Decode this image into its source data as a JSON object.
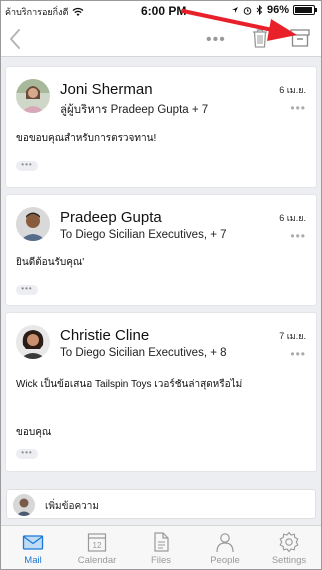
{
  "statusbar": {
    "carrier": "ค้าบริการอยกิ่งตี",
    "time": "6:00 PM",
    "battery": "96%",
    "battery_level": 0.96
  },
  "toolbar": {
    "more": "•••"
  },
  "messages": [
    {
      "sender": "Joni Sherman",
      "recipients": "ลู่ผู้บริหาร Pradeep Gupta + 7",
      "date": "6 เม.ย.",
      "body": [
        "ขอขอบคุณสำหรับการตรวจทาน!"
      ],
      "expand": "•••",
      "more": "•••"
    },
    {
      "sender": "Pradeep Gupta",
      "recipients": "To Diego Sicilian Executives, + 7",
      "date": "6 เม.ย.",
      "body": [
        "ยินดีต้อนรับคุณ'"
      ],
      "expand": "•••",
      "more": "•••"
    },
    {
      "sender": "Christie Cline",
      "recipients": "To Diego Sicilian Executives, + 8",
      "date": "7 เม.ย.",
      "body": [
        "Wick เป็นข้อเสนอ Tailspin Toys เวอร์ชันล่าสุดหรือไม่",
        "ขอบคุณ"
      ],
      "expand": "•••",
      "more": "•••"
    }
  ],
  "reply": {
    "placeholder": "เพิ่มข้อความ"
  },
  "tabs": [
    {
      "label": "Mail",
      "icon": "mail-icon",
      "active": true
    },
    {
      "label": "Calendar",
      "icon": "calendar-icon",
      "day": "12"
    },
    {
      "label": "Files",
      "icon": "files-icon"
    },
    {
      "label": "People",
      "icon": "people-icon"
    },
    {
      "label": "Settings",
      "icon": "settings-icon"
    }
  ],
  "colors": {
    "accent": "#1b78d6",
    "arrow": "#e8202a"
  }
}
